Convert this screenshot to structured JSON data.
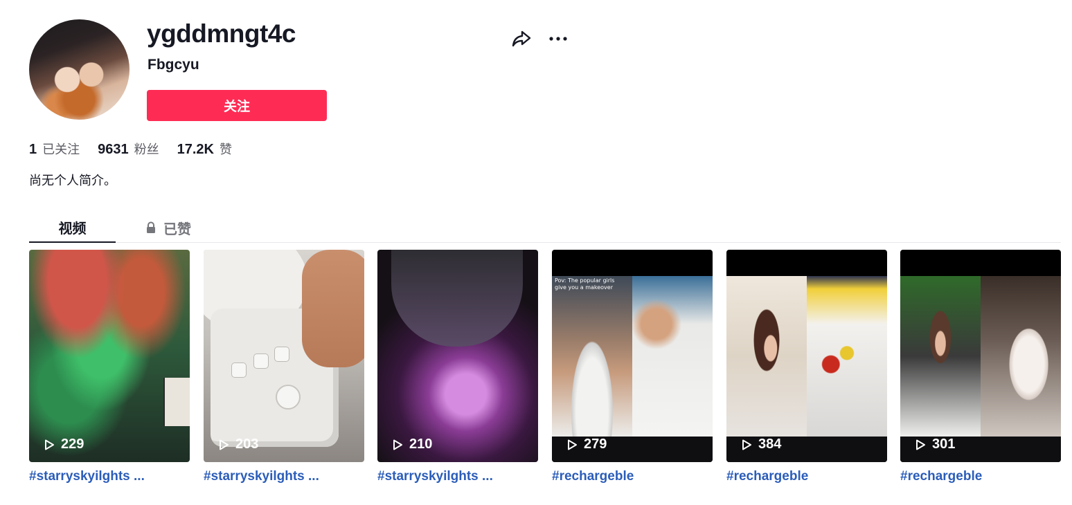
{
  "profile": {
    "username": "ygddmngt4c",
    "nickname": "Fbgcyu",
    "follow_label": "关注",
    "bio": "尚无个人简介。"
  },
  "stats": [
    {
      "value": "1",
      "label": "已关注"
    },
    {
      "value": "9631",
      "label": "粉丝"
    },
    {
      "value": "17.2K",
      "label": "赞"
    }
  ],
  "actions": {
    "share_icon": "share-icon",
    "more_icon": "more-icon"
  },
  "tabs": [
    {
      "label": "视频",
      "active": true
    },
    {
      "label": "已赞",
      "locked": true
    }
  ],
  "videos": [
    {
      "views": "229",
      "caption": "#starryskyilghts ..."
    },
    {
      "views": "203",
      "caption": "#starryskyilghts ..."
    },
    {
      "views": "210",
      "caption": "#starryskyilghts ..."
    },
    {
      "views": "279",
      "caption": "#rechargeble",
      "overlay_text": "Pov: The popular girls give you a makeover"
    },
    {
      "views": "384",
      "caption": "#rechargeble"
    },
    {
      "views": "301",
      "caption": "#rechargeble"
    }
  ],
  "colors": {
    "accent": "#fe2c55",
    "link": "#2b5db9"
  }
}
